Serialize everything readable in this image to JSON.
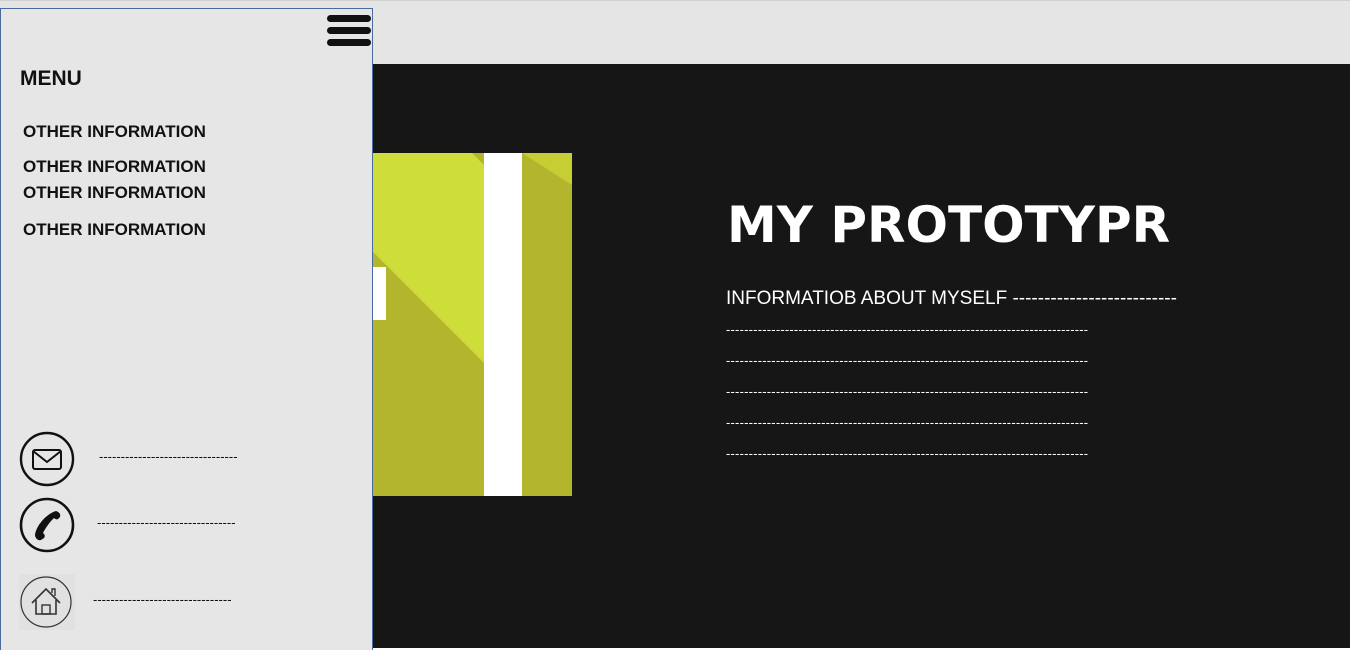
{
  "hero": {
    "title": "MY PROTOTYPR",
    "about_lines": [
      "INFORMATIOB ABOUT MYSELF --------------------------",
      "--------------------------------------------------------------------------------",
      "--------------------------------------------------------------------------------",
      "--------------------------------------------------------------------------------",
      "--------------------------------------------------------------------------------",
      "--------------------------------------------------------------------------------"
    ]
  },
  "sidebar": {
    "menu_title": "MENU",
    "menu_icon": "hamburger-icon",
    "items": [
      {
        "label": "OTHER INFORMATION"
      },
      {
        "label": "OTHER INFORMATION"
      },
      {
        "label": "OTHER INFORMATION"
      },
      {
        "label": "OTHER INFORMATION"
      }
    ],
    "contacts": [
      {
        "icon": "email-icon",
        "text": "--------------------------------"
      },
      {
        "icon": "phone-icon",
        "text": "--------------------------------"
      },
      {
        "icon": "home-icon",
        "text": "--------------------------------"
      }
    ]
  },
  "colors": {
    "hero_background": "#161616",
    "topbar_background": "#e5e5e5",
    "sidebar_background": "#e6e6e6",
    "sidebar_border": "#4a6aa0",
    "accent_light": "#cfdd3b",
    "accent_dark": "#b3b62c"
  }
}
